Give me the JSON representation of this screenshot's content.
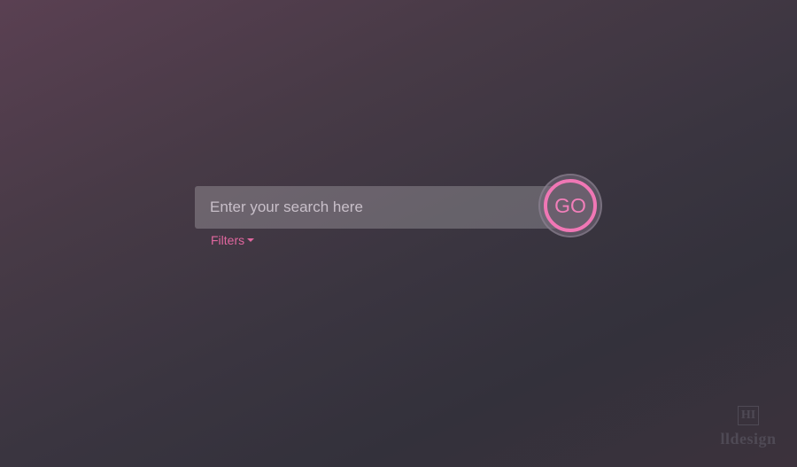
{
  "search": {
    "placeholder": "Enter your search here",
    "value": ""
  },
  "go_button": {
    "label": "GO"
  },
  "filters": {
    "label": "Filters",
    "icon": "caret-down-icon"
  },
  "watermark": {
    "monogram": "HI",
    "text": "lldesign"
  },
  "colors": {
    "accent": "#f077b5",
    "filter_text": "#e0679f",
    "background_start": "#5a4052",
    "background_end": "#33313b"
  }
}
